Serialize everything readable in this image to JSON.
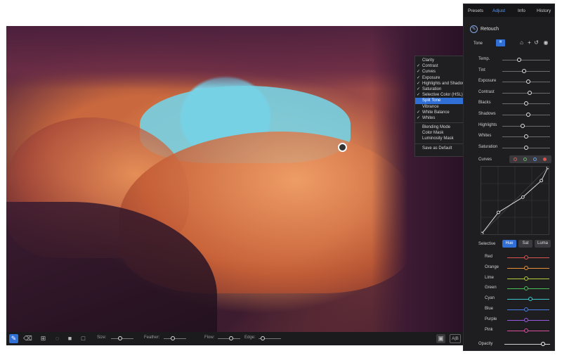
{
  "panel": {
    "tabs": [
      {
        "label": "Presets",
        "active": false
      },
      {
        "label": "Adjust",
        "active": true
      },
      {
        "label": "Info",
        "active": false
      },
      {
        "label": "History",
        "active": false
      }
    ],
    "section_title": "Retouch",
    "tone_label": "Tone",
    "tone_icons": [
      "stamp-icon",
      "add-icon",
      "undo-icon",
      "toggle-icon"
    ],
    "tone_sliders": [
      {
        "label": "Temp.",
        "value": 0.35
      },
      {
        "label": "Tint",
        "value": 0.45
      },
      {
        "label": "Exposure",
        "value": 0.55
      },
      {
        "label": "Contrast",
        "value": 0.58
      },
      {
        "label": "Blacks",
        "value": 0.5
      },
      {
        "label": "Shadows",
        "value": 0.55
      },
      {
        "label": "Highlights",
        "value": 0.42
      },
      {
        "label": "Whites",
        "value": 0.5
      },
      {
        "label": "Saturation",
        "value": 0.5
      }
    ],
    "curves_label": "Curves",
    "curve_channels": [
      {
        "name": "red",
        "color": "#d9534f"
      },
      {
        "name": "green",
        "color": "#5cb85c"
      },
      {
        "name": "blue",
        "color": "#5a9cf5"
      },
      {
        "name": "rgb",
        "color": "#d9534f"
      }
    ],
    "curve_points": [
      [
        0,
        0
      ],
      [
        0.25,
        0.32
      ],
      [
        0.62,
        0.55
      ],
      [
        0.9,
        0.8
      ],
      [
        1,
        1
      ]
    ],
    "selective_label": "Selective",
    "selective_modes": [
      {
        "label": "Hue",
        "active": true
      },
      {
        "label": "Sat",
        "active": false
      },
      {
        "label": "Luma",
        "active": false
      }
    ],
    "selective_colors": [
      {
        "label": "Red",
        "color": "#d9534f",
        "value": 0.45
      },
      {
        "label": "Orange",
        "color": "#e8913a",
        "value": 0.45
      },
      {
        "label": "Lime",
        "color": "#b5cf3a",
        "value": 0.45
      },
      {
        "label": "Green",
        "color": "#4cbf5a",
        "value": 0.45
      },
      {
        "label": "Cyan",
        "color": "#3ac8c8",
        "value": 0.55
      },
      {
        "label": "Blue",
        "color": "#4a7ee6",
        "value": 0.45
      },
      {
        "label": "Purple",
        "color": "#9a5ae0",
        "value": 0.45
      },
      {
        "label": "Pink",
        "color": "#d8509e",
        "value": 0.45
      }
    ],
    "opacity_label": "Opacity",
    "opacity_value": 0.85
  },
  "context_menu": {
    "items": [
      {
        "label": "Clarity",
        "checked": false,
        "selected": false
      },
      {
        "label": "Contrast",
        "checked": true,
        "selected": false
      },
      {
        "label": "Curves",
        "checked": true,
        "selected": false
      },
      {
        "label": "Exposure",
        "checked": true,
        "selected": false
      },
      {
        "label": "Highlights and Shadows",
        "checked": true,
        "selected": false
      },
      {
        "label": "Saturation",
        "checked": true,
        "selected": false
      },
      {
        "label": "Selective Color (HSL)",
        "checked": true,
        "selected": false
      },
      {
        "label": "Split Tone",
        "checked": false,
        "selected": true
      },
      {
        "label": "Vibrance",
        "checked": false,
        "selected": false
      },
      {
        "label": "White Balance",
        "checked": true,
        "selected": false
      },
      {
        "label": "Whites",
        "checked": true,
        "selected": false
      }
    ],
    "group2": [
      "Blending Mode",
      "Color Mask",
      "Luminosity Mask"
    ],
    "save_default": "Save as Default"
  },
  "toolbar": {
    "size_label": "Size:",
    "feather_label": "Feather:",
    "flow_label": "Flow:",
    "edge_label": "Edge:",
    "size_value": 0.4,
    "feather_value": 0.4,
    "flow_value": 0.6,
    "edge_value": 0.2,
    "compare_label": "A|B"
  }
}
